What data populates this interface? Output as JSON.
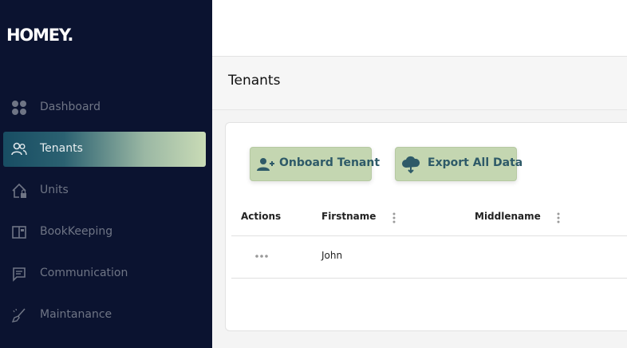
{
  "app": {
    "logo_text": "HOMEY."
  },
  "sidebar": {
    "items": [
      {
        "label": "Dashboard",
        "icon": "dashboard-icon",
        "active": false
      },
      {
        "label": "Tenants",
        "icon": "users-icon",
        "active": true
      },
      {
        "label": "Units",
        "icon": "house-lock-icon",
        "active": false
      },
      {
        "label": "BookKeeping",
        "icon": "book-icon",
        "active": false
      },
      {
        "label": "Communication",
        "icon": "chat-icon",
        "active": false
      },
      {
        "label": "Maintanance",
        "icon": "broom-icon",
        "active": false
      }
    ]
  },
  "page": {
    "title": "Tenants"
  },
  "toolbar": {
    "onboard_label": "Onboard Tenant",
    "export_label": "Export All Data"
  },
  "table": {
    "columns": [
      "Actions",
      "Firstname",
      "Middlename"
    ],
    "rows": [
      {
        "firstname": "John",
        "middlename": ""
      }
    ]
  },
  "colors": {
    "sidebar_bg": "#0b1330",
    "accent_button": "#c4d6b1",
    "accent_text": "#2e5a68"
  }
}
